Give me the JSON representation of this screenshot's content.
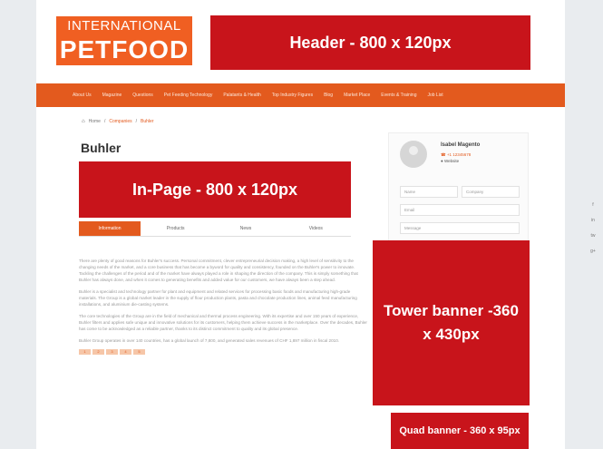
{
  "logo": {
    "line1": "INTERNATIONAL",
    "line2": "PETFOOD"
  },
  "banners": {
    "header": "Header - 800 x 120px",
    "inpage": "In-Page - 800 x 120px",
    "tower": "Tower banner -360 x 430px",
    "quad": "Quad banner - 360 x 95px"
  },
  "nav": {
    "items": [
      "About Us",
      "Magazine",
      "Questions",
      "Pet Feeding Technology",
      "Palatants & Health",
      "Top Industry Figures",
      "Blog",
      "Market Place",
      "Events & Training",
      "Job List"
    ]
  },
  "breadcrumb": {
    "home": "Home",
    "companies": "Companies",
    "current": "Buhler"
  },
  "page_title": "Buhler",
  "tabs": [
    "Information",
    "Products",
    "News",
    "Videos"
  ],
  "paragraphs": [
    "There are plenty of good reasons for Buhler's success. Personal commitment, clever entrepreneurial decision making, a high level of sensitivity to the changing needs of the market, and a core business that has become a byword for quality and consistency, founded on the Buhler's power to innovate. Tackling the challenges of the period and of the market have always played a role in shaping the direction of the company. This is simply something that Buhler has always done, and when it comes to generating benefits and added value for our customers, we have always been a step ahead.",
    "Buhler is a specialist and technology partner for plant and equipment and related services for processing basic foods and manufacturing high-grade materials. The Group is a global market leader in the supply of flour production plants, pasta and chocolate production lines, animal feed manufacturing installations, and aluminium die-casting systems.",
    "The core technologies of the Group are in the field of mechanical and thermal process engineering. With its expertise and over 150 years of experience, Buhler filters and applies safe unique and innovative solutions for its customers, helping them achieve success in the marketplace. Over the decades, Buhler has come to be acknowledged as a reliable partner, thanks to its distinct commitment to quality and its global presence.",
    "Buhler Group operates in over 140 countries, has a global launch of 7,800, and generated sales revenues of CHF 1,897 million in fiscal 2010."
  ],
  "pagination": [
    "1",
    "2",
    "3",
    "4",
    "5"
  ],
  "contact": {
    "name": "Isabel Magento",
    "phone": "+1 12345678",
    "website": "Website",
    "fields": {
      "name": "Name",
      "company": "Company",
      "email": "Email",
      "message": "Message"
    }
  },
  "share": [
    "f",
    "in",
    "tw",
    "g+"
  ],
  "colors": {
    "accent": "#e35a1e",
    "banner": "#c8141b",
    "logo": "#f05f22"
  }
}
